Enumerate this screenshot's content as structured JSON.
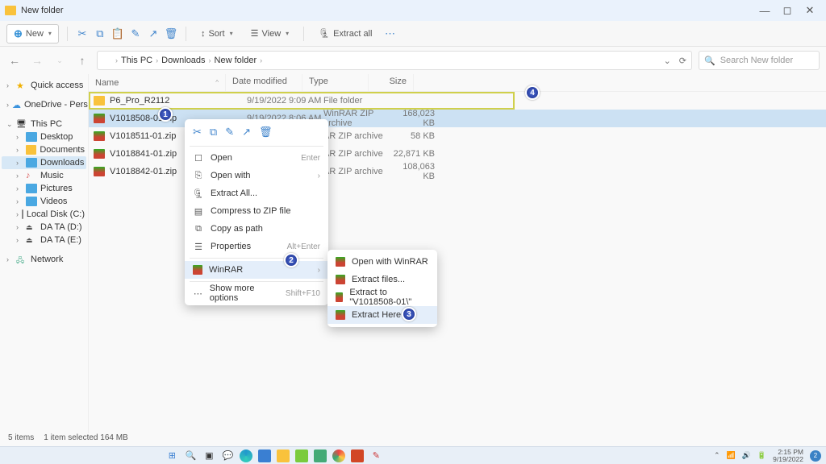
{
  "window": {
    "title": "New folder"
  },
  "toolbar": {
    "new_label": "New",
    "sort_label": "Sort",
    "view_label": "View",
    "extract_all_label": "Extract all"
  },
  "breadcrumbs": [
    "This PC",
    "Downloads",
    "New folder"
  ],
  "search": {
    "placeholder": "Search New folder"
  },
  "sidebar": {
    "quick_access": "Quick access",
    "onedrive": "OneDrive - Personal",
    "this_pc": "This PC",
    "desktop": "Desktop",
    "documents": "Documents",
    "downloads": "Downloads",
    "music": "Music",
    "pictures": "Pictures",
    "videos": "Videos",
    "local_disk": "Local Disk (C:)",
    "data_d": "DA TA (D:)",
    "data_e": "DA TA (E:)",
    "network": "Network"
  },
  "columns": {
    "name": "Name",
    "date": "Date modified",
    "type": "Type",
    "size": "Size"
  },
  "rows": [
    {
      "name": "P6_Pro_R2112",
      "date": "9/19/2022 9:09 AM",
      "type": "File folder",
      "size": ""
    },
    {
      "name": "V1018508-01.zip",
      "date": "9/19/2022 8:06 AM",
      "type": "WinRAR ZIP archive",
      "size": "168,023 KB"
    },
    {
      "name": "V1018511-01.zip",
      "date": "",
      "type": "AR ZIP archive",
      "size": "58 KB"
    },
    {
      "name": "V1018841-01.zip",
      "date": "",
      "type": "AR ZIP archive",
      "size": "22,871 KB"
    },
    {
      "name": "V1018842-01.zip",
      "date": "",
      "type": "AR ZIP archive",
      "size": "108,063 KB"
    }
  ],
  "context": {
    "open": "Open",
    "open_hint": "Enter",
    "open_with": "Open with",
    "extract_all": "Extract All...",
    "compress": "Compress to ZIP file",
    "copy_path": "Copy as path",
    "properties": "Properties",
    "properties_hint": "Alt+Enter",
    "winrar": "WinRAR",
    "show_more": "Show more options",
    "show_more_hint": "Shift+F10"
  },
  "submenu": {
    "open_winrar": "Open with WinRAR",
    "extract_files": "Extract files...",
    "extract_to": "Extract to \"V1018508-01\\\"",
    "extract_here": "Extract Here"
  },
  "status": {
    "items": "5 items",
    "selected": "1 item selected  164 MB"
  },
  "tray": {
    "time": "2:15 PM",
    "date": "9/19/2022",
    "notif": "2"
  },
  "callouts": {
    "c1": "1",
    "c2": "2",
    "c3": "3",
    "c4": "4"
  }
}
